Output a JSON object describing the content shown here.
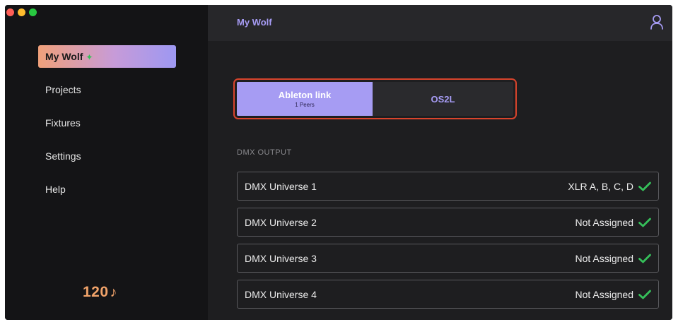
{
  "colors": {
    "accent": "#a69cf3",
    "highlight_outline": "#d9442c",
    "check": "#36c05a",
    "bpm": "#f1a36a"
  },
  "sidebar": {
    "items": [
      {
        "label": "My Wolf",
        "active": true,
        "icon": "spark-icon"
      },
      {
        "label": "Projects",
        "active": false
      },
      {
        "label": "Fixtures",
        "active": false
      },
      {
        "label": "Settings",
        "active": false
      },
      {
        "label": "Help",
        "active": false
      }
    ],
    "bpm": "120",
    "bpm_icon": "music-note-icon"
  },
  "header": {
    "title": "My Wolf",
    "user_icon": "user-icon"
  },
  "sync": {
    "options": [
      {
        "label": "Ableton link",
        "sub": "1 Peers",
        "active": true
      },
      {
        "label": "OS2L",
        "active": false
      }
    ]
  },
  "dmx": {
    "section_label": "DMX OUTPUT",
    "universes": [
      {
        "name": "DMX Universe 1",
        "status": "XLR A, B, C, D"
      },
      {
        "name": "DMX Universe 2",
        "status": "Not Assigned"
      },
      {
        "name": "DMX Universe 3",
        "status": "Not Assigned"
      },
      {
        "name": "DMX Universe 4",
        "status": "Not Assigned"
      }
    ]
  }
}
